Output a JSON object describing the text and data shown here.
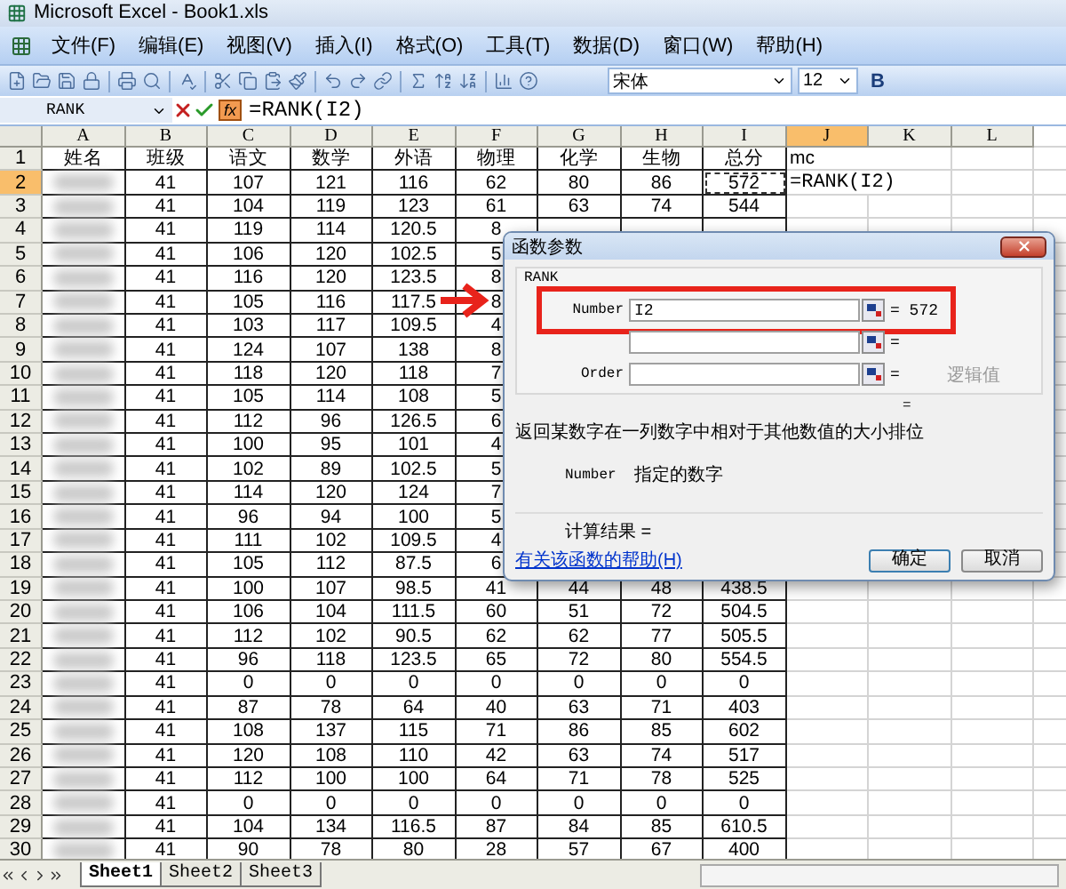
{
  "window": {
    "title": "Microsoft Excel - Book1.xls"
  },
  "menu": [
    "文件(F)",
    "编辑(E)",
    "视图(V)",
    "插入(I)",
    "格式(O)",
    "工具(T)",
    "数据(D)",
    "窗口(W)",
    "帮助(H)"
  ],
  "toolbar": {
    "font": "宋体",
    "size": "12",
    "bold": "B"
  },
  "formula_bar": {
    "name_box": "RANK",
    "function_button": "fx",
    "formula": "=RANK(I2)"
  },
  "sheet": {
    "columns": [
      {
        "label": "A",
        "selected": false
      },
      {
        "label": "B",
        "selected": false
      },
      {
        "label": "C",
        "selected": false
      },
      {
        "label": "D",
        "selected": false
      },
      {
        "label": "E",
        "selected": false
      },
      {
        "label": "F",
        "selected": false
      },
      {
        "label": "G",
        "selected": false
      },
      {
        "label": "H",
        "selected": false
      },
      {
        "label": "I",
        "selected": false
      },
      {
        "label": "J",
        "selected": true
      },
      {
        "label": "K",
        "selected": false
      },
      {
        "label": "L",
        "selected": false
      }
    ],
    "rows": [
      {
        "label": "1",
        "selected": false,
        "cells": [
          "姓名",
          "班级",
          "语文",
          "数学",
          "外语",
          "物理",
          "化学",
          "生物",
          "总分",
          "mc"
        ]
      },
      {
        "label": "2",
        "selected": true,
        "marquee": true,
        "cells": [
          "",
          "41",
          "107",
          "121",
          "116",
          "62",
          "80",
          "86",
          "572",
          "=RANK(I2)"
        ]
      },
      {
        "label": "3",
        "selected": false,
        "cells": [
          "",
          "41",
          "104",
          "119",
          "123",
          "61",
          "63",
          "74",
          "544"
        ]
      },
      {
        "label": "4",
        "selected": false,
        "cells": [
          "",
          "41",
          "119",
          "114",
          "120.5",
          "8"
        ]
      },
      {
        "label": "5",
        "selected": false,
        "cells": [
          "",
          "41",
          "106",
          "120",
          "102.5",
          "5"
        ]
      },
      {
        "label": "6",
        "selected": false,
        "cells": [
          "",
          "41",
          "116",
          "120",
          "123.5",
          "8"
        ]
      },
      {
        "label": "7",
        "selected": false,
        "cells": [
          "",
          "41",
          "105",
          "116",
          "117.5",
          "8"
        ]
      },
      {
        "label": "8",
        "selected": false,
        "cells": [
          "",
          "41",
          "103",
          "117",
          "109.5",
          "4"
        ]
      },
      {
        "label": "9",
        "selected": false,
        "cells": [
          "",
          "41",
          "124",
          "107",
          "138",
          "8"
        ]
      },
      {
        "label": "10",
        "selected": false,
        "cells": [
          "",
          "41",
          "118",
          "120",
          "118",
          "7"
        ]
      },
      {
        "label": "11",
        "selected": false,
        "cells": [
          "",
          "41",
          "105",
          "114",
          "108",
          "5"
        ]
      },
      {
        "label": "12",
        "selected": false,
        "cells": [
          "",
          "41",
          "112",
          "96",
          "126.5",
          "6"
        ]
      },
      {
        "label": "13",
        "selected": false,
        "cells": [
          "",
          "41",
          "100",
          "95",
          "101",
          "4"
        ]
      },
      {
        "label": "14",
        "selected": false,
        "cells": [
          "",
          "41",
          "102",
          "89",
          "102.5",
          "5"
        ]
      },
      {
        "label": "15",
        "selected": false,
        "cells": [
          "",
          "41",
          "114",
          "120",
          "124",
          "7"
        ]
      },
      {
        "label": "16",
        "selected": false,
        "cells": [
          "",
          "41",
          "96",
          "94",
          "100",
          "5"
        ]
      },
      {
        "label": "17",
        "selected": false,
        "cells": [
          "",
          "41",
          "111",
          "102",
          "109.5",
          "4"
        ]
      },
      {
        "label": "18",
        "selected": false,
        "cells": [
          "",
          "41",
          "105",
          "112",
          "87.5",
          "6"
        ]
      },
      {
        "label": "19",
        "selected": false,
        "cells": [
          "",
          "41",
          "100",
          "107",
          "98.5",
          "41",
          "44",
          "48",
          "438.5"
        ]
      },
      {
        "label": "20",
        "selected": false,
        "cells": [
          "",
          "41",
          "106",
          "104",
          "111.5",
          "60",
          "51",
          "72",
          "504.5"
        ]
      },
      {
        "label": "21",
        "selected": false,
        "cells": [
          "",
          "41",
          "112",
          "102",
          "90.5",
          "62",
          "62",
          "77",
          "505.5"
        ]
      },
      {
        "label": "22",
        "selected": false,
        "cells": [
          "",
          "41",
          "96",
          "118",
          "123.5",
          "65",
          "72",
          "80",
          "554.5"
        ]
      },
      {
        "label": "23",
        "selected": false,
        "cells": [
          "",
          "41",
          "0",
          "0",
          "0",
          "0",
          "0",
          "0",
          "0"
        ]
      },
      {
        "label": "24",
        "selected": false,
        "cells": [
          "",
          "41",
          "87",
          "78",
          "64",
          "40",
          "63",
          "71",
          "403"
        ]
      },
      {
        "label": "25",
        "selected": false,
        "cells": [
          "",
          "41",
          "108",
          "137",
          "115",
          "71",
          "86",
          "85",
          "602"
        ]
      },
      {
        "label": "26",
        "selected": false,
        "cells": [
          "",
          "41",
          "120",
          "108",
          "110",
          "42",
          "63",
          "74",
          "517"
        ]
      },
      {
        "label": "27",
        "selected": false,
        "cells": [
          "",
          "41",
          "112",
          "100",
          "100",
          "64",
          "71",
          "78",
          "525"
        ]
      },
      {
        "label": "28",
        "selected": false,
        "cells": [
          "",
          "41",
          "0",
          "0",
          "0",
          "0",
          "0",
          "0",
          "0"
        ]
      },
      {
        "label": "29",
        "selected": false,
        "cells": [
          "",
          "41",
          "104",
          "134",
          "116.5",
          "87",
          "84",
          "85",
          "610.5"
        ]
      },
      {
        "label": "30",
        "selected": false,
        "cells": [
          "",
          "41",
          "90",
          "78",
          "80",
          "28",
          "57",
          "67",
          "400"
        ]
      }
    ]
  },
  "dialog": {
    "title": "函数参数",
    "function": "RANK",
    "args": [
      {
        "label": "Number",
        "value": "I2",
        "result": "= 572",
        "highlighted": true
      },
      {
        "result": "=",
        "highlighted": false
      },
      {
        "label": "Order",
        "result": "=",
        "hint": "逻辑值",
        "highlighted": false
      }
    ],
    "total": "=",
    "description": "返回某数字在一列数字中相对于其他数值的大小排位",
    "arg_help": {
      "name": "Number",
      "text": "指定的数字"
    },
    "result_label": "计算结果 =",
    "help_link": "有关该函数的帮助(H)",
    "buttons": [
      {
        "label": "确定",
        "default": true
      },
      {
        "label": "取消",
        "default": false
      }
    ]
  },
  "sheet_tabs": [
    {
      "label": "Sheet1",
      "selected": true
    },
    {
      "label": "Sheet2",
      "selected": false
    },
    {
      "label": "Sheet3",
      "selected": false
    }
  ]
}
